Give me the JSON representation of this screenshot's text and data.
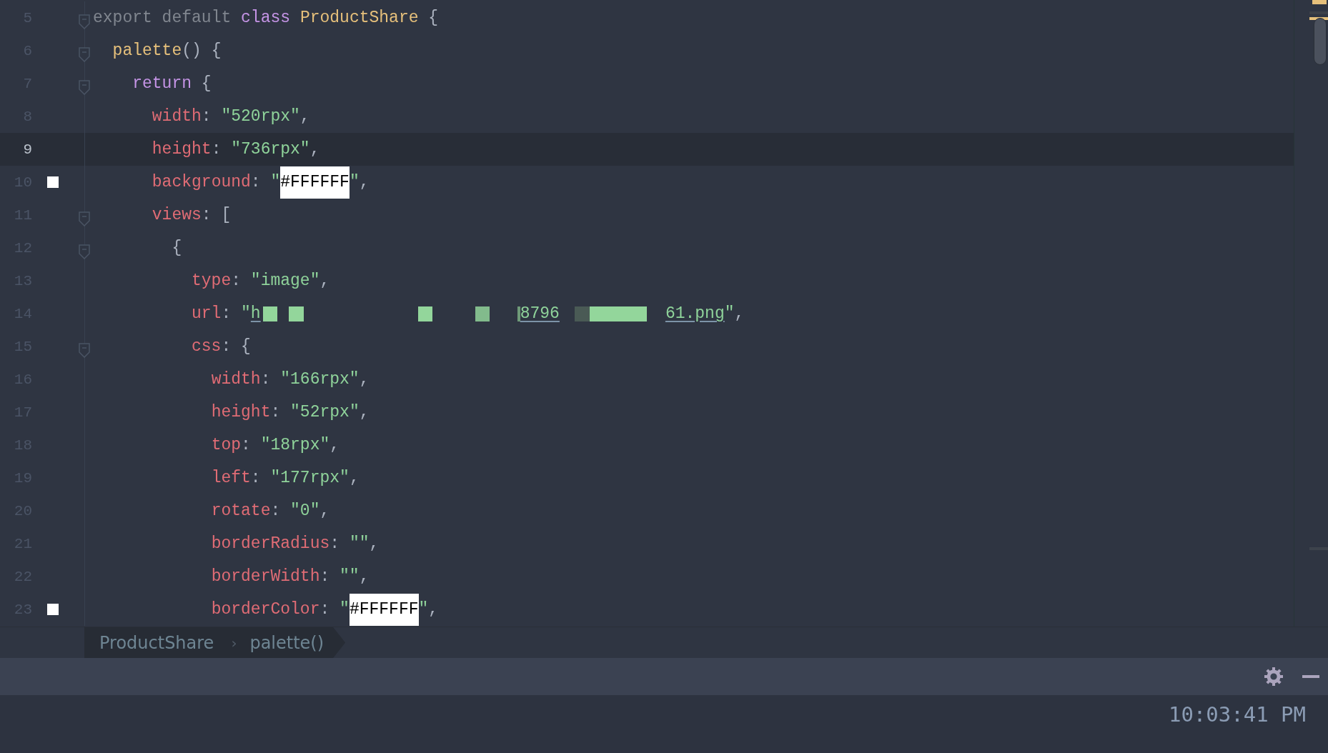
{
  "editor": {
    "lines": [
      {
        "number": "5",
        "current": false,
        "expanded": true,
        "tokens": [
          {
            "kind": "keyword",
            "text": "export default "
          },
          {
            "kind": "storage",
            "text": "class "
          },
          {
            "kind": "entity",
            "text": "ProductShare "
          },
          {
            "kind": "punct",
            "text": "{"
          }
        ],
        "children": [
          {
            "number": "6",
            "current": false,
            "expanded": true,
            "tokens": [
              {
                "kind": "entity",
                "text": "palette"
              },
              {
                "kind": "punct",
                "text": "() {"
              }
            ],
            "children": [
              {
                "number": "7",
                "current": false,
                "expanded": true,
                "tokens": [
                  {
                    "kind": "storage",
                    "text": "return "
                  },
                  {
                    "kind": "punct",
                    "text": "{"
                  }
                ],
                "children": [
                  {
                    "number": "8",
                    "current": false,
                    "tokens": [
                      {
                        "kind": "property",
                        "text": "width"
                      },
                      {
                        "kind": "punct",
                        "text": ": "
                      },
                      {
                        "kind": "string",
                        "text": "\"520rpx\""
                      },
                      {
                        "kind": "punct",
                        "text": ","
                      }
                    ]
                  },
                  {
                    "number": "9",
                    "current": true,
                    "tokens": [
                      {
                        "kind": "property",
                        "text": "height"
                      },
                      {
                        "kind": "punct",
                        "text": ": "
                      },
                      {
                        "kind": "string",
                        "text": "\"736rpx\""
                      },
                      {
                        "kind": "punct",
                        "text": ","
                      }
                    ]
                  },
                  {
                    "number": "10",
                    "current": false,
                    "color": "#ffffff",
                    "tokens": [
                      {
                        "kind": "property",
                        "text": "background"
                      },
                      {
                        "kind": "punct",
                        "text": ": "
                      },
                      {
                        "kind": "string",
                        "text": "\""
                      },
                      {
                        "kind": "color_literal",
                        "text": "#FFFFFF"
                      },
                      {
                        "kind": "string",
                        "text": "\""
                      },
                      {
                        "kind": "punct",
                        "text": ","
                      }
                    ]
                  },
                  {
                    "number": "11",
                    "current": false,
                    "expanded": true,
                    "tokens": [
                      {
                        "kind": "property",
                        "text": "views"
                      },
                      {
                        "kind": "punct",
                        "text": ": ["
                      }
                    ],
                    "children": [
                      {
                        "number": "12",
                        "current": false,
                        "expanded": true,
                        "tokens": [
                          {
                            "kind": "punct",
                            "text": "{"
                          }
                        ],
                        "children": [
                          {
                            "number": "13",
                            "current": false,
                            "tokens": [
                              {
                                "kind": "property",
                                "text": "type"
                              },
                              {
                                "kind": "punct",
                                "text": ": "
                              },
                              {
                                "kind": "string",
                                "text": "\"image\""
                              },
                              {
                                "kind": "punct",
                                "text": ","
                              }
                            ]
                          },
                          {
                            "number": "14",
                            "current": false,
                            "tokens": [
                              {
                                "kind": "property",
                                "text": "url"
                              },
                              {
                                "kind": "punct",
                                "text": ": "
                              },
                              {
                                "kind": "string",
                                "text": "\""
                              },
                              {
                                "kind": "link",
                                "text": "h"
                              },
                              {
                                "kind": "redacted"
                              },
                              {
                                "kind": "redacted"
                              },
                              {
                                "kind": "redacted"
                              },
                              {
                                "kind": "redacted"
                              },
                              {
                                "kind": "redacted"
                              },
                              {
                                "kind": "link",
                                "text": "8796"
                              },
                              {
                                "kind": "redacted"
                              },
                              {
                                "kind": "redacted"
                              },
                              {
                                "kind": "link",
                                "text": "61.png"
                              },
                              {
                                "kind": "string",
                                "text": "\""
                              },
                              {
                                "kind": "punct",
                                "text": ","
                              }
                            ]
                          },
                          {
                            "number": "15",
                            "current": false,
                            "expanded": true,
                            "tokens": [
                              {
                                "kind": "property",
                                "text": "css"
                              },
                              {
                                "kind": "punct",
                                "text": ": {"
                              }
                            ],
                            "children": [
                              {
                                "number": "16",
                                "current": false,
                                "tokens": [
                                  {
                                    "kind": "property",
                                    "text": "width"
                                  },
                                  {
                                    "kind": "punct",
                                    "text": ": "
                                  },
                                  {
                                    "kind": "string",
                                    "text": "\"166rpx\""
                                  },
                                  {
                                    "kind": "punct",
                                    "text": ","
                                  }
                                ]
                              },
                              {
                                "number": "17",
                                "current": false,
                                "tokens": [
                                  {
                                    "kind": "property",
                                    "text": "height"
                                  },
                                  {
                                    "kind": "punct",
                                    "text": ": "
                                  },
                                  {
                                    "kind": "string",
                                    "text": "\"52rpx\""
                                  },
                                  {
                                    "kind": "punct",
                                    "text": ","
                                  }
                                ]
                              },
                              {
                                "number": "18",
                                "current": false,
                                "tokens": [
                                  {
                                    "kind": "property",
                                    "text": "top"
                                  },
                                  {
                                    "kind": "punct",
                                    "text": ": "
                                  },
                                  {
                                    "kind": "string",
                                    "text": "\"18rpx\""
                                  },
                                  {
                                    "kind": "punct",
                                    "text": ","
                                  }
                                ]
                              },
                              {
                                "number": "19",
                                "current": false,
                                "tokens": [
                                  {
                                    "kind": "property",
                                    "text": "left"
                                  },
                                  {
                                    "kind": "punct",
                                    "text": ": "
                                  },
                                  {
                                    "kind": "string",
                                    "text": "\"177rpx\""
                                  },
                                  {
                                    "kind": "punct",
                                    "text": ","
                                  }
                                ]
                              },
                              {
                                "number": "20",
                                "current": false,
                                "tokens": [
                                  {
                                    "kind": "property",
                                    "text": "rotate"
                                  },
                                  {
                                    "kind": "punct",
                                    "text": ": "
                                  },
                                  {
                                    "kind": "string",
                                    "text": "\"0\""
                                  },
                                  {
                                    "kind": "punct",
                                    "text": ","
                                  }
                                ]
                              },
                              {
                                "number": "21",
                                "current": false,
                                "tokens": [
                                  {
                                    "kind": "property",
                                    "text": "borderRadius"
                                  },
                                  {
                                    "kind": "punct",
                                    "text": ": "
                                  },
                                  {
                                    "kind": "string",
                                    "text": "\"\""
                                  },
                                  {
                                    "kind": "punct",
                                    "text": ","
                                  }
                                ]
                              },
                              {
                                "number": "22",
                                "current": false,
                                "tokens": [
                                  {
                                    "kind": "property",
                                    "text": "borderWidth"
                                  },
                                  {
                                    "kind": "punct",
                                    "text": ": "
                                  },
                                  {
                                    "kind": "string",
                                    "text": "\"\""
                                  },
                                  {
                                    "kind": "punct",
                                    "text": ","
                                  }
                                ]
                              },
                              {
                                "number": "23",
                                "current": false,
                                "color": "#ffffff",
                                "tokens": [
                                  {
                                    "kind": "property",
                                    "text": "borderColor"
                                  },
                                  {
                                    "kind": "punct",
                                    "text": ": "
                                  },
                                  {
                                    "kind": "string",
                                    "text": "\""
                                  },
                                  {
                                    "kind": "color_literal",
                                    "text": "#FFFFFF"
                                  },
                                  {
                                    "kind": "string",
                                    "text": "\""
                                  },
                                  {
                                    "kind": "punct",
                                    "text": ","
                                  }
                                ]
                              }
                            ]
                          }
                        ]
                      }
                    ]
                  }
                ]
              }
            ]
          }
        ]
      }
    ]
  },
  "breadcrumb": {
    "items": [
      {
        "label": "ProductShare"
      },
      {
        "label": "palette()"
      }
    ],
    "separator": "›"
  },
  "status": {
    "clock": "10:03:41 PM"
  }
}
